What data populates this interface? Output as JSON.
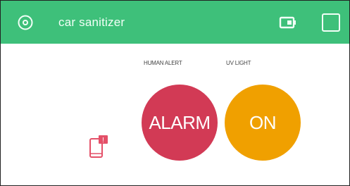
{
  "theme": {
    "header_bg": "#3ec07a",
    "header_fg": "#f2fff7",
    "alarm_bg": "#d23a55",
    "on_bg": "#f0a000",
    "notify_color": "#e45068"
  },
  "header": {
    "title": "car sanitizer",
    "menu_icon": "target-circle-icon",
    "device_icon": "device-battery-icon",
    "square_icon": "square-outline-icon"
  },
  "widgets": {
    "human_alert": {
      "label": "HUMAN ALERT",
      "value": "ALARM"
    },
    "uv_light": {
      "label": "UV LIGHT",
      "value": "ON"
    }
  },
  "notification": {
    "icon": "phone-notification-icon",
    "badge": "!"
  }
}
